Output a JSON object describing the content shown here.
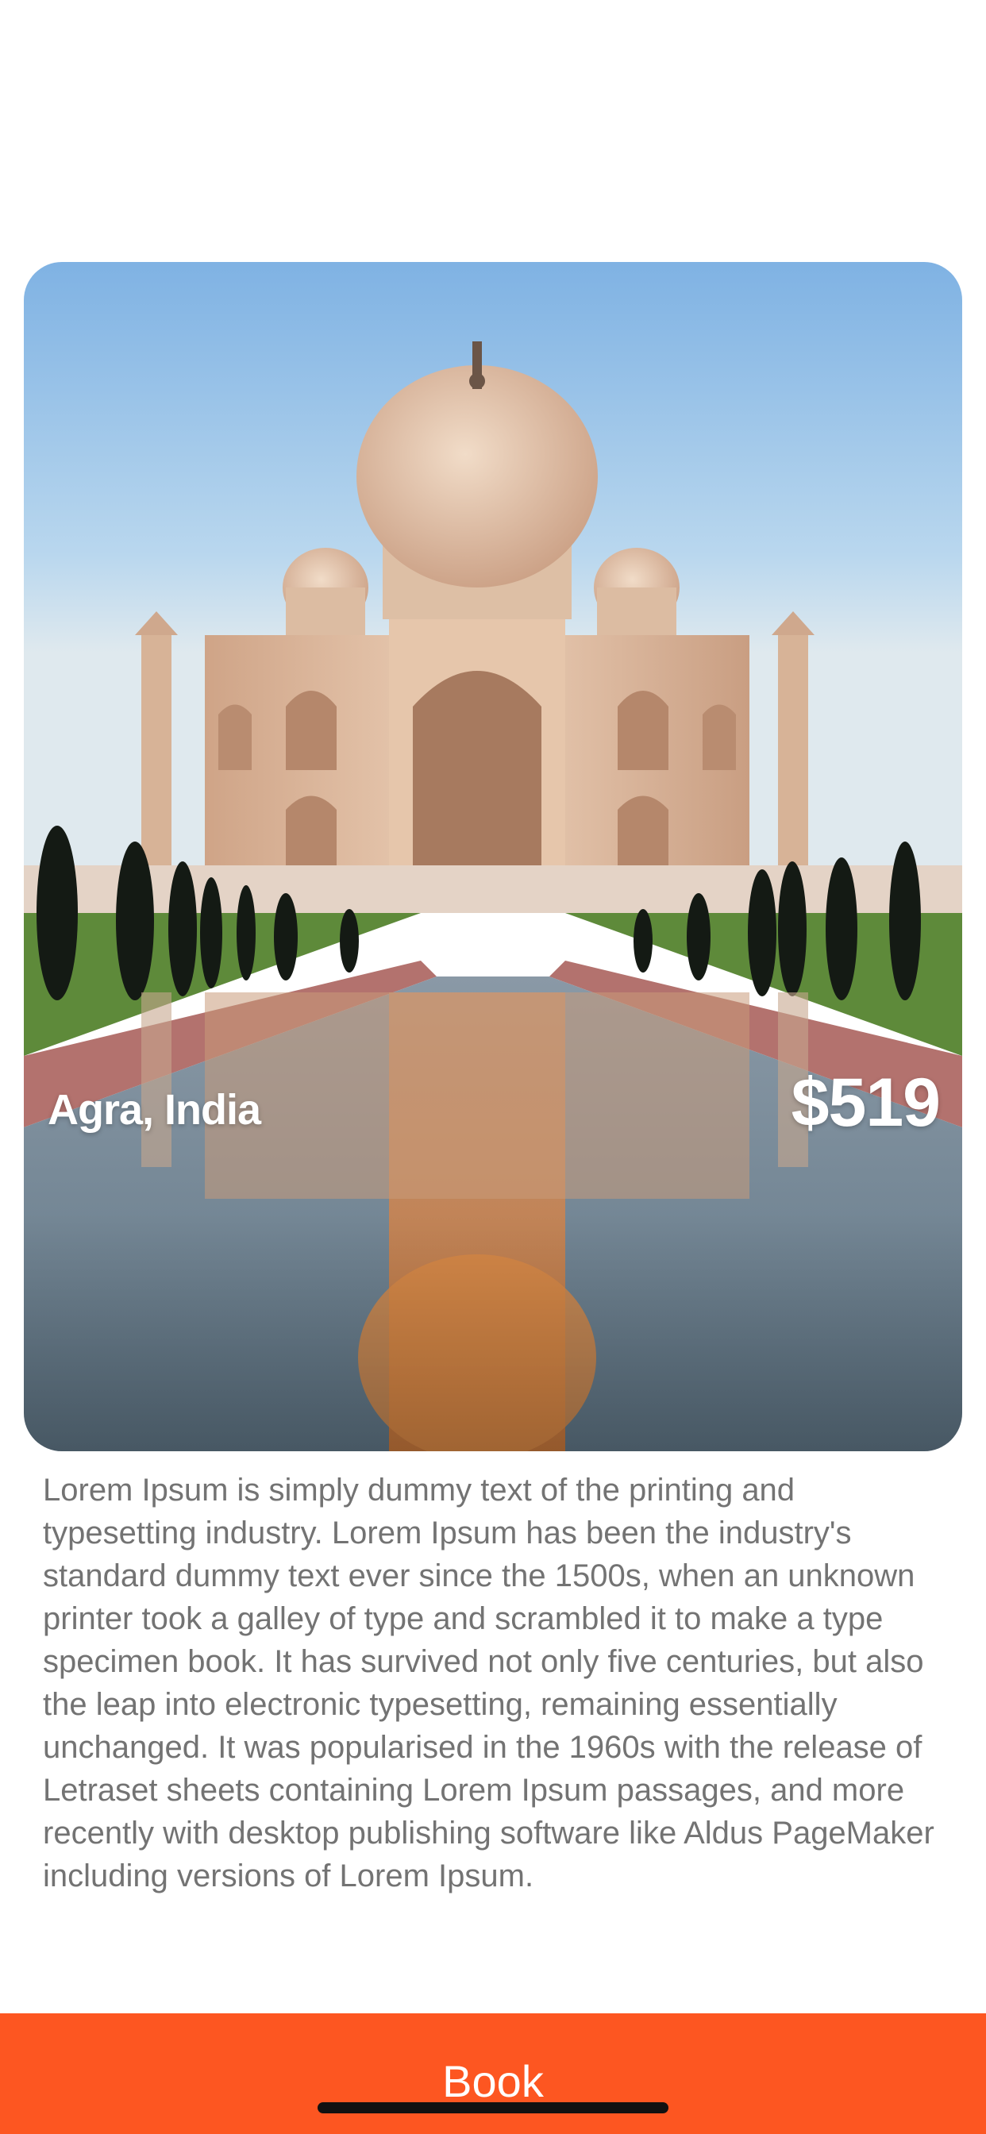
{
  "destination": {
    "location": "Agra, India",
    "price": "$519",
    "image_subject": "Taj Mahal with reflecting pool"
  },
  "description": "Lorem Ipsum is simply dummy text of the printing and typesetting industry. Lorem Ipsum has been the industry's standard dummy text ever since the 1500s, when an unknown printer took a galley of type and scrambled it to make a type specimen book. It has survived not only five centuries, but also the leap into electronic typesetting, remaining essentially unchanged. It was popularised in the 1960s with the release of Letraset sheets containing Lorem Ipsum passages, and more recently with desktop publishing software like Aldus PageMaker including versions of Lorem Ipsum.",
  "actions": {
    "book_label": "Book"
  },
  "colors": {
    "accent": "#fd5621",
    "description_text": "#737373"
  }
}
